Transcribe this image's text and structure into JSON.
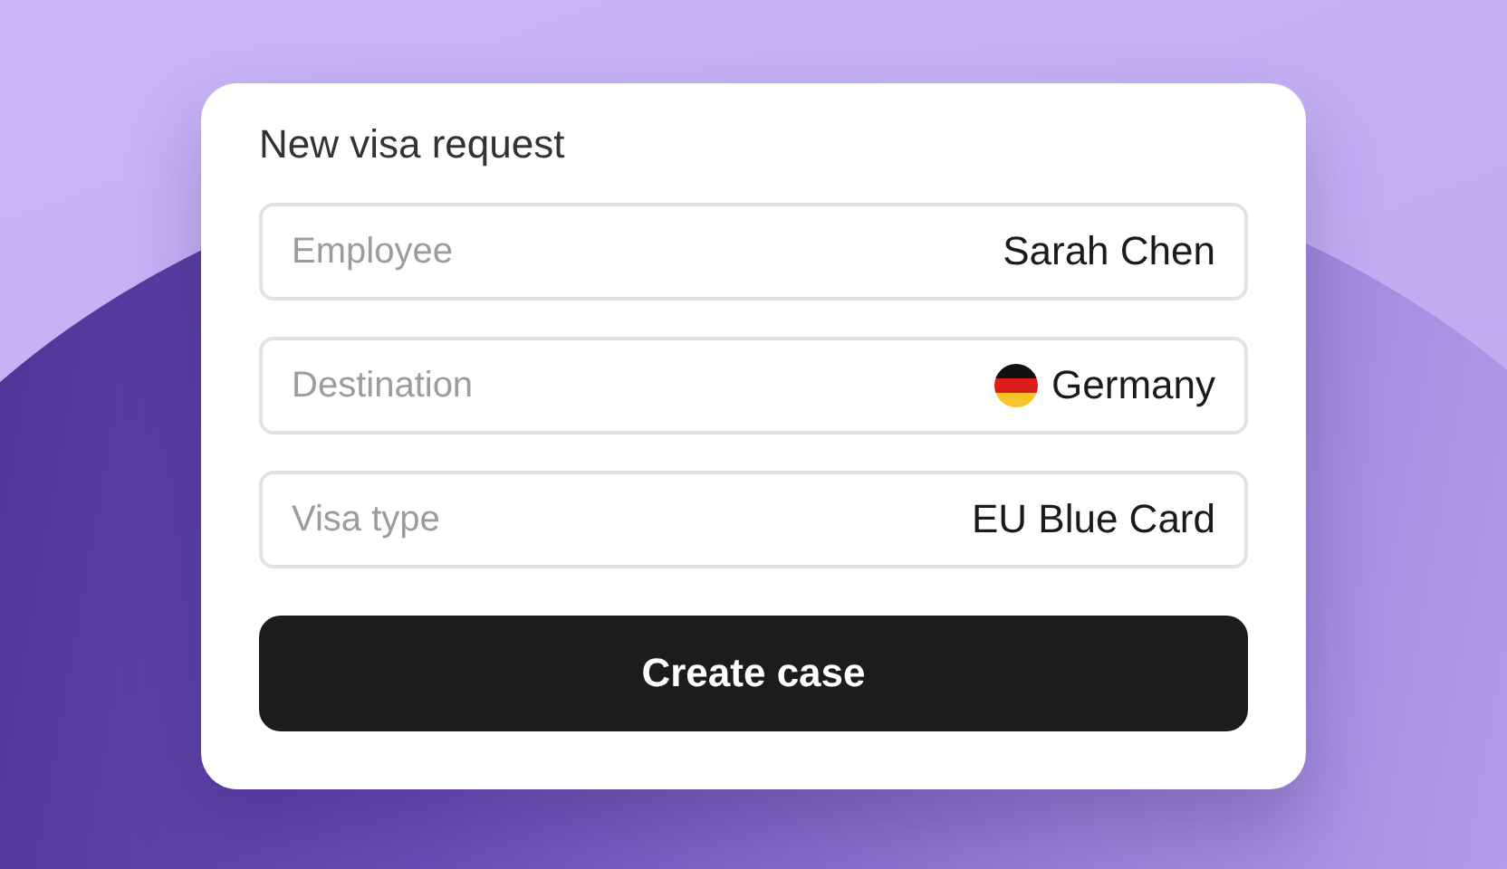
{
  "form": {
    "title": "New visa request",
    "fields": [
      {
        "kind": "text",
        "label": "Employee",
        "value": "Sarah Chen"
      },
      {
        "kind": "country",
        "label": "Destination",
        "value": "Germany"
      },
      {
        "kind": "text",
        "label": "Visa type",
        "value": "EU Blue Card"
      }
    ],
    "submit": "Create case"
  }
}
